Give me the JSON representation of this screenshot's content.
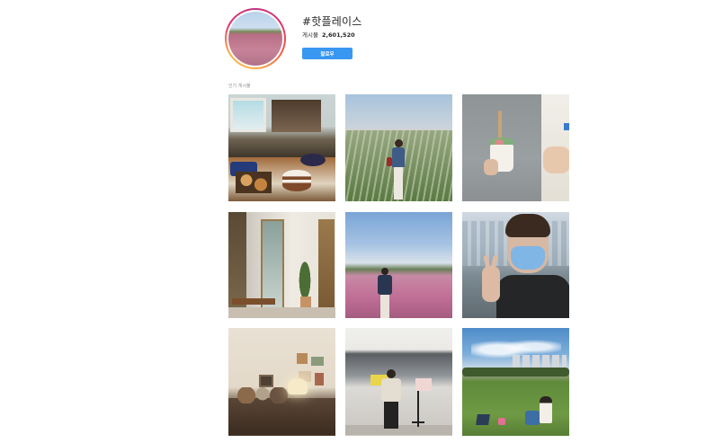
{
  "profile": {
    "hashtag": "#핫플레이스",
    "posts_label": "게시물",
    "posts_count": "2,601,520",
    "follow_label": "팔로우"
  },
  "section": {
    "label": "인기 게시물"
  },
  "grid": {
    "posts": [
      {
        "name": "bakery-counter"
      },
      {
        "name": "pampas-grass-field"
      },
      {
        "name": "ice-cream-cup"
      },
      {
        "name": "door-room-plant"
      },
      {
        "name": "pink-muhly-field"
      },
      {
        "name": "masked-selfie"
      },
      {
        "name": "vintage-room"
      },
      {
        "name": "cafe-counter"
      },
      {
        "name": "park-lawn"
      }
    ]
  },
  "colors": {
    "follow_button": "#3897f0",
    "secondary_text": "#8e8e8e",
    "primary_text": "#262626"
  }
}
